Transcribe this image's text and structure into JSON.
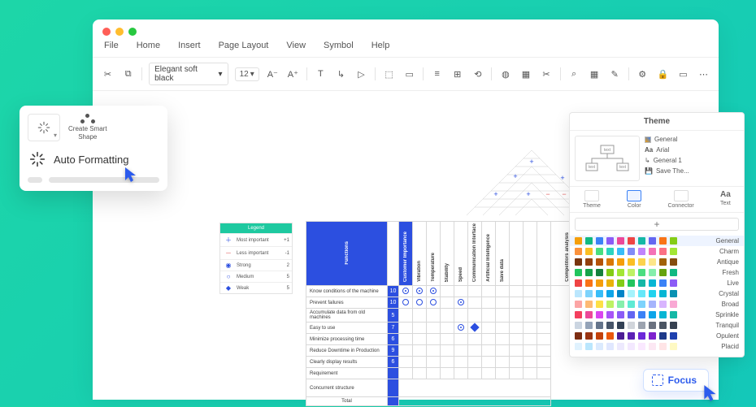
{
  "menu": {
    "file": "File",
    "home": "Home",
    "insert": "Insert",
    "page_layout": "Page Layout",
    "view": "View",
    "symbol": "Symbol",
    "help": "Help"
  },
  "toolbar": {
    "font": "Elegant soft black",
    "size": "12"
  },
  "popover": {
    "smart_shape_l1": "Create Smart",
    "smart_shape_l2": "Shape",
    "auto_formatting": "Auto Formatting"
  },
  "legend": {
    "title": "Legend",
    "rows": [
      {
        "sym": "＋",
        "label": "Most important",
        "val": "+1"
      },
      {
        "sym": "－",
        "label": "Less important",
        "val": "-1"
      },
      {
        "sym": "◉",
        "label": "Strong",
        "val": "2"
      },
      {
        "sym": "○",
        "label": "Medium",
        "val": "5"
      },
      {
        "sym": "◆",
        "label": "Weak",
        "val": "5"
      }
    ]
  },
  "matrix": {
    "cat_label": "Functions",
    "col_headers": [
      "Customer Importance",
      "Vibration",
      "Temperature",
      "Stability",
      "Speed",
      "Communication Interface",
      "Artificial Intelligence",
      "Save data",
      "",
      "",
      "",
      "Competitors analysis"
    ],
    "roof": [
      {
        "r": 0,
        "c": 3,
        "s": "+"
      },
      {
        "r": 1,
        "c": 2,
        "s": "+"
      },
      {
        "r": 1,
        "c": 5,
        "s": "+"
      },
      {
        "r": 2,
        "c": 1,
        "s": "+"
      },
      {
        "r": 2,
        "c": 3,
        "s": "+"
      },
      {
        "r": 2,
        "c": 4,
        "s": "−"
      },
      {
        "r": 2,
        "c": 5,
        "s": "−"
      }
    ],
    "rows": [
      {
        "label": "Know conditions of the machine",
        "pri": "10",
        "cells": [
          "◉",
          "◉",
          "◉",
          "",
          "",
          "",
          "",
          ""
        ]
      },
      {
        "label": "Prevent failures",
        "pri": "10",
        "cells": [
          "○",
          "○",
          "○",
          "",
          "◉",
          "",
          "",
          ""
        ]
      },
      {
        "label": "Accumulate data from old machines",
        "pri": "5",
        "cells": [
          "",
          "",
          "",
          "",
          "",
          "",
          "",
          ""
        ]
      },
      {
        "label": "Easy to use",
        "pri": "7",
        "cells": [
          "",
          "",
          "",
          "",
          "◉",
          "◆",
          "",
          ""
        ]
      },
      {
        "label": "Minimize processing time",
        "pri": "6",
        "cells": [
          "",
          "",
          "",
          "",
          "",
          "",
          "",
          ""
        ]
      },
      {
        "label": "Reduce Downtime in Production",
        "pri": "9",
        "cells": [
          "",
          "",
          "",
          "",
          "",
          "",
          "",
          ""
        ]
      },
      {
        "label": "Clearly display results",
        "pri": "6",
        "cells": [
          "",
          "",
          "",
          "",
          "",
          "",
          "",
          ""
        ]
      },
      {
        "label": "Requirement",
        "pri": "",
        "cells": [
          "",
          "",
          "",
          "",
          "",
          "",
          "",
          ""
        ]
      }
    ],
    "concurrent": "Concurrent structure",
    "total": "Total"
  },
  "theme": {
    "title": "Theme",
    "info": [
      {
        "icon": "grid",
        "label": "General"
      },
      {
        "icon": "Aa",
        "label": "Arial"
      },
      {
        "icon": "line",
        "label": "General 1"
      },
      {
        "icon": "save",
        "label": "Save The..."
      }
    ],
    "tabs": [
      "Theme",
      "Color",
      "Connector",
      "Text"
    ],
    "add": "+",
    "schemes": [
      {
        "name": "General",
        "sel": true,
        "c": [
          "#f59e0b",
          "#10b981",
          "#3b82f6",
          "#8b5cf6",
          "#ec4899",
          "#ef4444",
          "#14b8a6",
          "#6366f1",
          "#f97316",
          "#84cc16"
        ]
      },
      {
        "name": "Charm",
        "c": [
          "#fb923c",
          "#fbbf24",
          "#4ade80",
          "#2dd4bf",
          "#38bdf8",
          "#818cf8",
          "#c084fc",
          "#f472b6",
          "#fb7185",
          "#a3e635"
        ]
      },
      {
        "name": "Antique",
        "c": [
          "#78350f",
          "#92400e",
          "#b45309",
          "#d97706",
          "#f59e0b",
          "#fbbf24",
          "#fcd34d",
          "#fde68a",
          "#a16207",
          "#854d0e"
        ]
      },
      {
        "name": "Fresh",
        "c": [
          "#22c55e",
          "#16a34a",
          "#15803d",
          "#84cc16",
          "#a3e635",
          "#bef264",
          "#4ade80",
          "#86efac",
          "#65a30d",
          "#10b981"
        ]
      },
      {
        "name": "Live",
        "c": [
          "#ef4444",
          "#f97316",
          "#f59e0b",
          "#eab308",
          "#84cc16",
          "#22c55e",
          "#14b8a6",
          "#06b6d4",
          "#3b82f6",
          "#8b5cf6"
        ]
      },
      {
        "name": "Crystal",
        "c": [
          "#bae6fd",
          "#7dd3fc",
          "#38bdf8",
          "#0ea5e9",
          "#0284c7",
          "#a5f3fc",
          "#67e8f9",
          "#22d3ee",
          "#06b6d4",
          "#0891b2"
        ]
      },
      {
        "name": "Broad",
        "c": [
          "#fca5a5",
          "#fdba74",
          "#fde047",
          "#bef264",
          "#86efac",
          "#5eead4",
          "#7dd3fc",
          "#a5b4fc",
          "#d8b4fe",
          "#f9a8d4"
        ]
      },
      {
        "name": "Sprinkle",
        "c": [
          "#f43f5e",
          "#ec4899",
          "#d946ef",
          "#a855f7",
          "#8b5cf6",
          "#6366f1",
          "#3b82f6",
          "#0ea5e9",
          "#06b6d4",
          "#14b8a6"
        ]
      },
      {
        "name": "Tranquil",
        "c": [
          "#cbd5e1",
          "#94a3b8",
          "#64748b",
          "#475569",
          "#334155",
          "#d1d5db",
          "#9ca3af",
          "#6b7280",
          "#4b5563",
          "#374151"
        ]
      },
      {
        "name": "Opulent",
        "c": [
          "#7c2d12",
          "#9a3412",
          "#c2410c",
          "#ea580c",
          "#4c1d95",
          "#5b21b6",
          "#6d28d9",
          "#7e22ce",
          "#1e3a8a",
          "#1e40af"
        ]
      },
      {
        "name": "Placid",
        "c": [
          "#e0f2fe",
          "#bae6fd",
          "#dbeafe",
          "#e0e7ff",
          "#ede9fe",
          "#f3e8ff",
          "#fae8ff",
          "#fce7f3",
          "#ffe4e6",
          "#fef9c3"
        ]
      }
    ]
  },
  "focus_label": "Focus"
}
